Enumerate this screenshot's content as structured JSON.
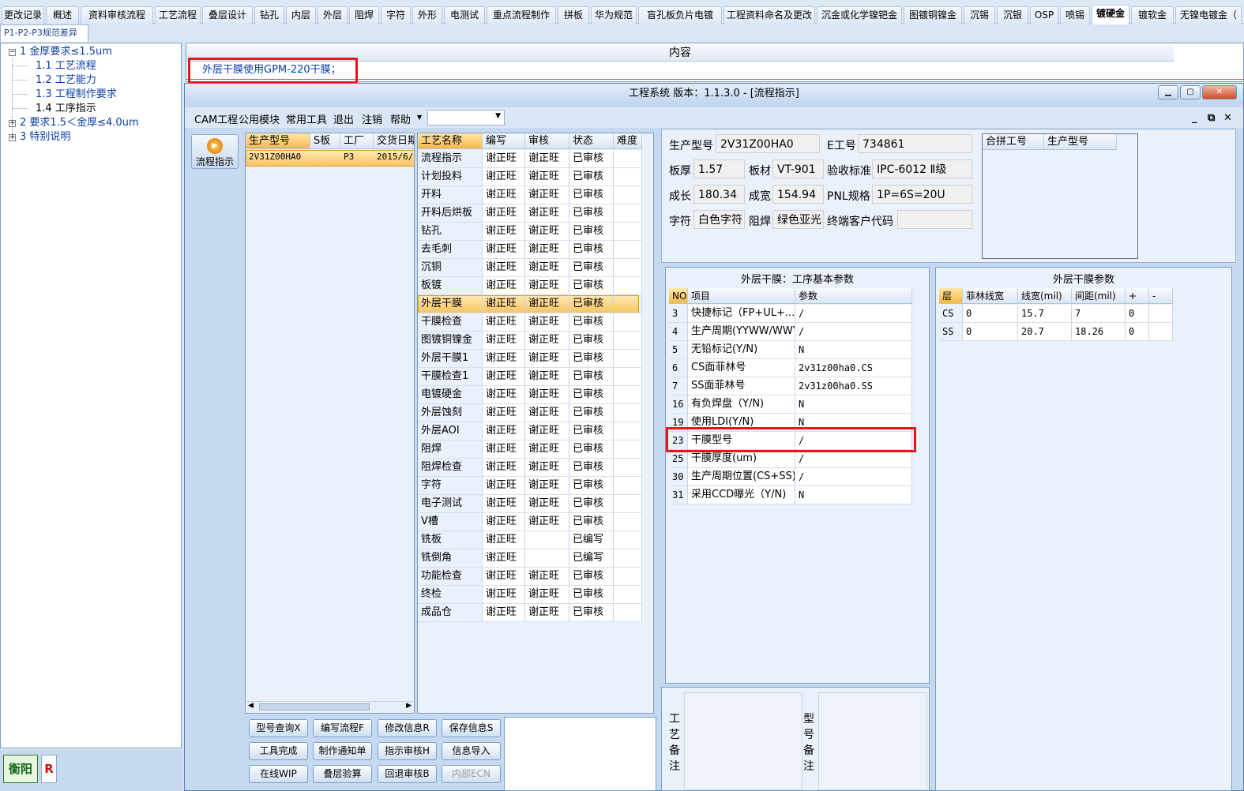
{
  "tabs": [
    "更改记录",
    "概述",
    "资料审核流程",
    "工艺流程",
    "叠层设计",
    "钻孔",
    "内层",
    "外层",
    "阻焊",
    "字符",
    "外形",
    "电测试",
    "重点流程制作",
    "拼板",
    "华为规范",
    "盲孔板负片电镀",
    "工程资料命名及更改",
    "沉金或化学镍钯金",
    "图镀铜镍金",
    "沉锡",
    "沉银",
    "OSP",
    "喷锡",
    "镀硬金",
    "镀软金",
    "无镍电镀金（"
  ],
  "active_tab": "镀硬金",
  "subtab": "P1-P2-P3规范差异",
  "tree": [
    {
      "label": "1 金厚要求≤1.5um",
      "level": 0,
      "expanded": true
    },
    {
      "label": "1.1 工艺流程",
      "level": 1
    },
    {
      "label": "1.2 工艺能力",
      "level": 1
    },
    {
      "label": "1.3 工程制作要求",
      "level": 1
    },
    {
      "label": "1.4 工序指示",
      "level": 1,
      "selected": true
    },
    {
      "label": "2 要求1.5＜金厚≤4.0um",
      "level": 0,
      "expanded": false
    },
    {
      "label": "3 特别说明",
      "level": 0,
      "expanded": false
    }
  ],
  "status": {
    "location": "衡阳",
    "badge": "R"
  },
  "content": {
    "header": "内容",
    "row": "外层干膜使用GPM-220干膜；"
  },
  "window": {
    "title": "工程系统  版本：1.1.3.0 - [流程指示]",
    "menu": [
      "CAM工程",
      "公用模块",
      "常用工具",
      "退出",
      "注销",
      "帮助"
    ],
    "flow_btn": "流程指示"
  },
  "orders": {
    "headers": [
      "生产型号",
      "S板",
      "工厂",
      "交货日期"
    ],
    "rows": [
      [
        "2V31Z00HA0",
        "",
        "P3",
        "2015/6/"
      ]
    ]
  },
  "process": {
    "headers": [
      "工艺名称",
      "编写",
      "审核",
      "状态",
      "难度"
    ],
    "rows": [
      [
        "流程指示",
        "谢正旺",
        "谢正旺",
        "已审核"
      ],
      [
        "计划投料",
        "谢正旺",
        "谢正旺",
        "已审核"
      ],
      [
        "开料",
        "谢正旺",
        "谢正旺",
        "已审核"
      ],
      [
        "开料后烘板",
        "谢正旺",
        "谢正旺",
        "已审核"
      ],
      [
        "钻孔",
        "谢正旺",
        "谢正旺",
        "已审核"
      ],
      [
        "去毛刺",
        "谢正旺",
        "谢正旺",
        "已审核"
      ],
      [
        "沉铜",
        "谢正旺",
        "谢正旺",
        "已审核"
      ],
      [
        "板镀",
        "谢正旺",
        "谢正旺",
        "已审核"
      ],
      [
        "外层干膜",
        "谢正旺",
        "谢正旺",
        "已审核"
      ],
      [
        "干膜检查",
        "谢正旺",
        "谢正旺",
        "已审核"
      ],
      [
        "图镀铜镍金",
        "谢正旺",
        "谢正旺",
        "已审核"
      ],
      [
        "外层干膜1",
        "谢正旺",
        "谢正旺",
        "已审核"
      ],
      [
        "干膜检查1",
        "谢正旺",
        "谢正旺",
        "已审核"
      ],
      [
        "电镀硬金",
        "谢正旺",
        "谢正旺",
        "已审核"
      ],
      [
        "外层蚀刻",
        "谢正旺",
        "谢正旺",
        "已审核"
      ],
      [
        "外层AOI",
        "谢正旺",
        "谢正旺",
        "已审核"
      ],
      [
        "阻焊",
        "谢正旺",
        "谢正旺",
        "已审核"
      ],
      [
        "阻焊检查",
        "谢正旺",
        "谢正旺",
        "已审核"
      ],
      [
        "字符",
        "谢正旺",
        "谢正旺",
        "已审核"
      ],
      [
        "电子测试",
        "谢正旺",
        "谢正旺",
        "已审核"
      ],
      [
        "V槽",
        "谢正旺",
        "谢正旺",
        "已审核"
      ],
      [
        "铣板",
        "谢正旺",
        "",
        "已编写"
      ],
      [
        "铣倒角",
        "谢正旺",
        "",
        "已编写"
      ],
      [
        "功能检查",
        "谢正旺",
        "谢正旺",
        "已审核"
      ],
      [
        "终检",
        "谢正旺",
        "谢正旺",
        "已审核"
      ],
      [
        "成品仓",
        "谢正旺",
        "谢正旺",
        "已审核"
      ]
    ],
    "selected_index": 8
  },
  "info": {
    "labels": {
      "model": "生产型号",
      "eno": "E工号",
      "thick": "板厚",
      "material": "板材",
      "standard": "验收标准",
      "length": "成长",
      "width": "成宽",
      "pnl": "PNL规格",
      "char": "字符",
      "mask": "阻焊",
      "customer": "终端客户代码"
    },
    "values": {
      "model": "2V31Z00HA0",
      "eno": "734861",
      "thick": "1.57",
      "material": "VT-901",
      "standard": "IPC-6012 Ⅱ级",
      "length": "180.34",
      "width": "154.94",
      "pnl": "1P=6S=20U",
      "char": "白色字符",
      "mask": "绿色亚光",
      "customer": ""
    },
    "combine_headers": [
      "合拼工号",
      "生产型号"
    ]
  },
  "params": {
    "title": "外层干膜：工序基本参数",
    "headers": [
      "NO",
      "项目",
      "参数"
    ],
    "rows": [
      [
        "3",
        "快捷标记（FP+UL+...",
        "/"
      ],
      [
        "4",
        "生产周期(YYWW/WWYY)",
        "/"
      ],
      [
        "5",
        "无铅标记(Y/N)",
        "N"
      ],
      [
        "6",
        "CS面菲林号",
        "2v31z00ha0.CS"
      ],
      [
        "7",
        "SS面菲林号",
        "2v31z00ha0.SS"
      ],
      [
        "16",
        "有负焊盘（Y/N)",
        "N"
      ],
      [
        "19",
        "使用LDI(Y/N)",
        "N"
      ],
      [
        "23",
        "干膜型号",
        "/"
      ],
      [
        "25",
        "干膜厚度(um)",
        "/"
      ],
      [
        "30",
        "生产周期位置(CS+SS)",
        "/"
      ],
      [
        "31",
        "采用CCD曝光（Y/N)",
        "N"
      ]
    ]
  },
  "film": {
    "title": "外层干膜参数",
    "headers": [
      "层",
      "菲林线宽",
      "线宽(mil)",
      "间距(mil)",
      "+",
      "-"
    ],
    "rows": [
      [
        "CS",
        "0",
        "15.7",
        "7",
        "0",
        ""
      ],
      [
        "SS",
        "0",
        "20.7",
        "18.26",
        "0",
        ""
      ]
    ]
  },
  "buttons": [
    [
      "型号查询X",
      "编写流程F",
      "修改信息R",
      "保存信息S"
    ],
    [
      "工具完成",
      "制作通知单",
      "指示审核H",
      "信息导入"
    ],
    [
      "在线WIP",
      "叠层验算",
      "回退审核B",
      "内部ECN"
    ]
  ],
  "remarks": {
    "process_label": "工艺备注",
    "model_label": "型号备注"
  }
}
